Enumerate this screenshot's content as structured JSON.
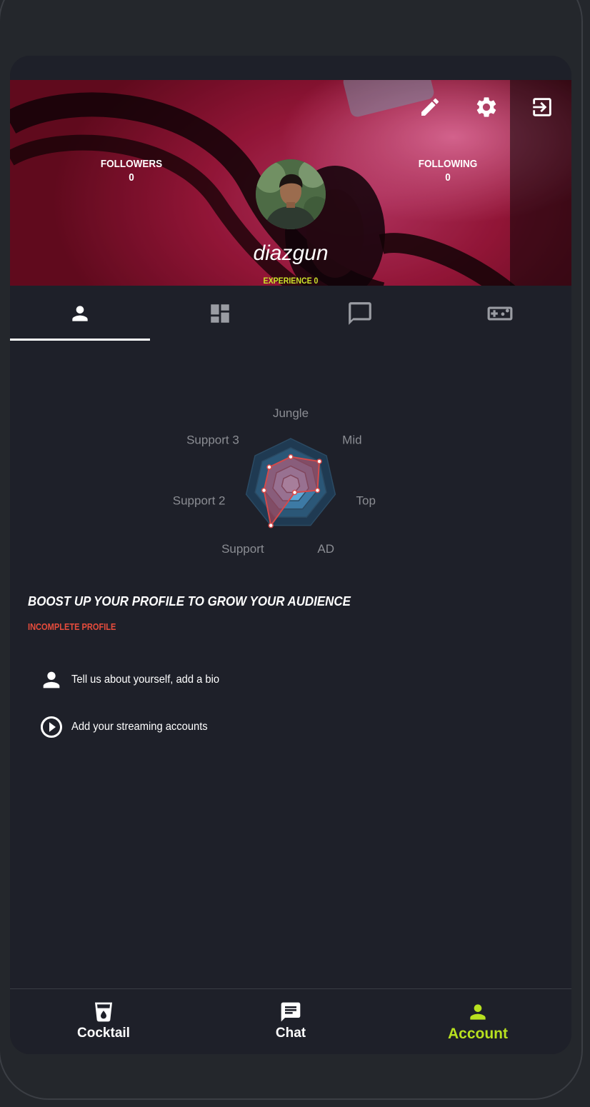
{
  "header": {
    "followers_label": "FOLLOWERS",
    "followers_count": "0",
    "following_label": "FOLLOWING",
    "following_count": "0",
    "username": "diazgun",
    "experience": "EXPERIENCE 0",
    "actions": [
      "pencil-icon",
      "gear-icon",
      "logout-icon"
    ]
  },
  "tabs": [
    {
      "icon": "person-icon",
      "active": true
    },
    {
      "icon": "dashboard-icon",
      "active": false
    },
    {
      "icon": "chat-bubble-icon",
      "active": false
    },
    {
      "icon": "gamepad-icon",
      "active": false
    }
  ],
  "chart_data": {
    "type": "radar",
    "axes": [
      "Jungle",
      "Mid",
      "Top",
      "AD",
      "Support",
      "Support 2",
      "Support 3"
    ],
    "rings": 5,
    "max": 5,
    "values": [
      3,
      4,
      3,
      1,
      5,
      3,
      3
    ],
    "series_color": "#d44a4a",
    "grid_color": "#5da7d6"
  },
  "profile": {
    "boost_title": "BOOST UP YOUR PROFILE TO GROW YOUR AUDIENCE",
    "status": "INCOMPLETE PROFILE",
    "tasks": [
      {
        "icon": "person-icon",
        "label": "Tell us about yourself, add a bio"
      },
      {
        "icon": "play-circle-icon",
        "label": "Add your streaming accounts"
      }
    ]
  },
  "bottom_nav": [
    {
      "icon": "cocktail-icon",
      "label": "Cocktail",
      "active": false
    },
    {
      "icon": "chat-icon",
      "label": "Chat",
      "active": false
    },
    {
      "icon": "account-icon",
      "label": "Account",
      "active": true
    }
  ],
  "colors": {
    "accent": "#b8e11f",
    "experience": "#cde32a",
    "warning": "#e74c3c",
    "background": "#1e2029"
  }
}
